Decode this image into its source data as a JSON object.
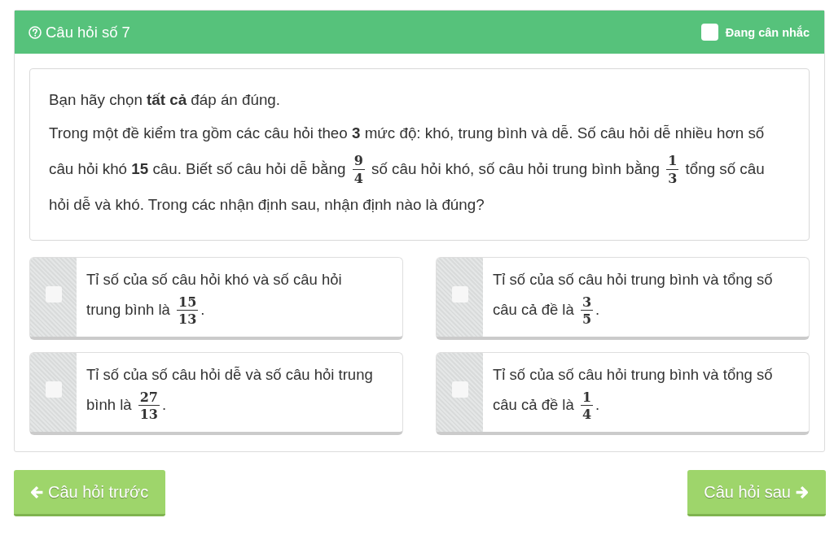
{
  "header": {
    "title": "Câu hỏi số 7",
    "flag": {
      "label": "Đang cân nhắc",
      "checked": false
    }
  },
  "question": {
    "instruction": "Bạn hãy chọn **tất cả** đáp án đúng.",
    "body": [
      {
        "kind": "text",
        "text": "Trong một đề kiểm tra gồm các câu hỏi theo **3** mức độ: khó, trung bình và dễ. Số câu hỏi dễ nhiều hơn số câu hỏi khó **15** câu. Biết số câu hỏi dễ bằng "
      },
      {
        "kind": "frac",
        "numerator": "9",
        "denominator": "4"
      },
      {
        "kind": "text",
        "text": " số câu hỏi khó, số câu hỏi trung bình bằng "
      },
      {
        "kind": "frac",
        "numerator": "1",
        "denominator": "3"
      },
      {
        "kind": "text",
        "text": " tổng số câu hỏi dễ và khó. Trong các nhận định sau, nhận định nào là đúng?"
      }
    ]
  },
  "options": [
    {
      "selected": false,
      "parts": [
        {
          "kind": "text",
          "text": "Tỉ số của số câu hỏi khó và số câu hỏi trung bình là "
        },
        {
          "kind": "frac",
          "numerator": "15",
          "denominator": "13"
        },
        {
          "kind": "text",
          "text": "."
        }
      ]
    },
    {
      "selected": false,
      "parts": [
        {
          "kind": "text",
          "text": "Tỉ số của số câu hỏi trung bình và tổng số câu cả đề là "
        },
        {
          "kind": "frac",
          "numerator": "3",
          "denominator": "5"
        },
        {
          "kind": "text",
          "text": "."
        }
      ]
    },
    {
      "selected": false,
      "parts": [
        {
          "kind": "text",
          "text": "Tỉ số của số câu hỏi dễ và số câu hỏi trung bình là "
        },
        {
          "kind": "frac",
          "numerator": "27",
          "denominator": "13"
        },
        {
          "kind": "text",
          "text": "."
        }
      ]
    },
    {
      "selected": false,
      "parts": [
        {
          "kind": "text",
          "text": "Tỉ số của số câu hỏi trung bình và tổng số câu cả đề là "
        },
        {
          "kind": "frac",
          "numerator": "1",
          "denominator": "4"
        },
        {
          "kind": "text",
          "text": "."
        }
      ]
    }
  ],
  "navigation": [
    {
      "kind": "prev",
      "label": "Câu hỏi trước"
    },
    {
      "kind": "next",
      "label": "Câu hỏi sau"
    }
  ]
}
